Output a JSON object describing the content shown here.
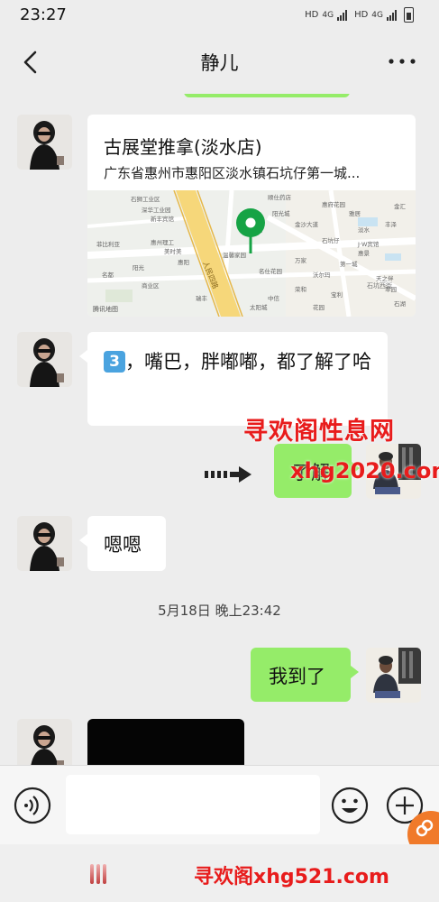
{
  "status": {
    "time": "23:27",
    "net1": "HD",
    "gen1": "4G",
    "net2": "HD",
    "gen2": "4G"
  },
  "header": {
    "title": "静儿"
  },
  "messages": {
    "location_title": "古展堂推拿(淡水店)",
    "location_address": "广东省惠州市惠阳区淡水镇石坑仔第一城...",
    "emoji_badge": "3",
    "text1": "，嘴巴，胖嘟嘟，都了解了哈",
    "reply_partial": "了解",
    "text2": "嗯嗯",
    "timestamp": "5月18日 晚上23:42",
    "text3": "我到了"
  },
  "map": {
    "labels": [
      "石狮工业区",
      "深华工业园",
      "新丰宾馆",
      "顺仕药店",
      "惠府花园",
      "阳光城",
      "金沙大道",
      "商业街",
      "石坑仔",
      "淡水",
      "J·W宾馆",
      "菲比利亚",
      "惠州理工",
      "美时美",
      "惠阳",
      "温馨家园",
      "名仕花园",
      "万家",
      "沃尔玛",
      "第一城",
      "天之伴",
      "名都",
      "阳光",
      "商业区",
      "荣和",
      "宝利",
      "惠景",
      "翠园",
      "石湖",
      "中信",
      "瑞丰",
      "太阳城",
      "花园",
      "雅居",
      "丰泽",
      "金汇"
    ],
    "road_label": "人民四路",
    "road_label2": "石坑西街",
    "attribution": "腾讯地图"
  },
  "watermarks": {
    "top_line1": "寻欢阁性息网",
    "top_line2": "xhg2020.com",
    "bottom": "寻欢阁xhg521.com"
  },
  "colors": {
    "bubble_green": "#95ec69",
    "pin_green": "#16a345",
    "background": "#ededed",
    "watermark_red": "#e81c1c"
  }
}
